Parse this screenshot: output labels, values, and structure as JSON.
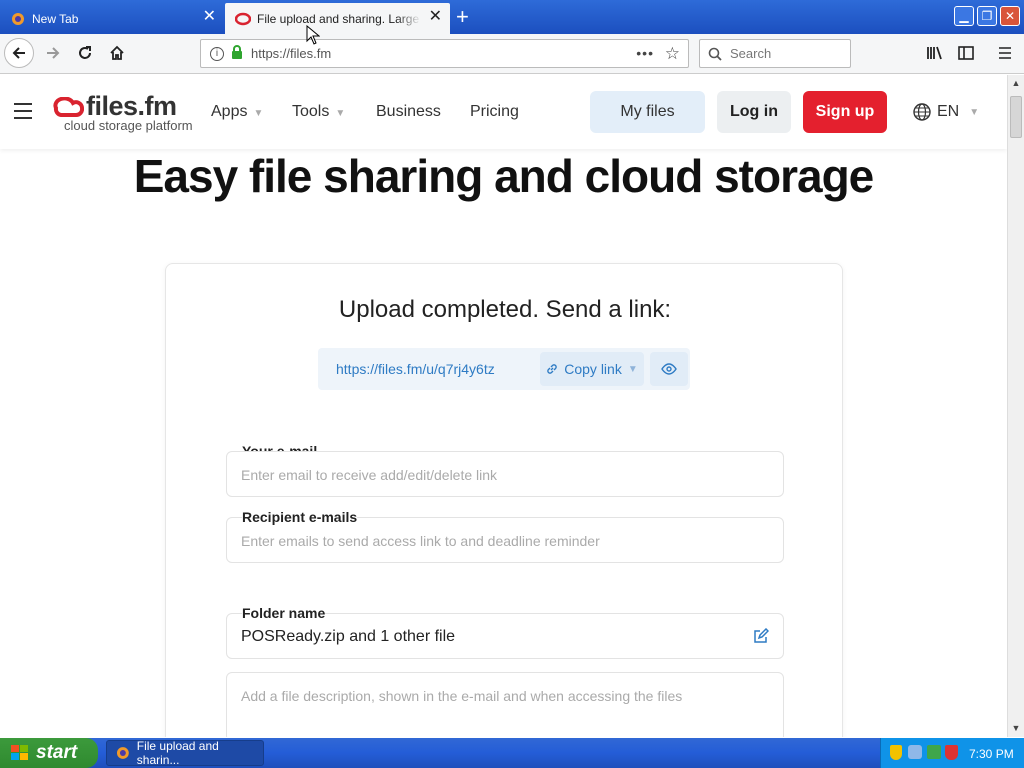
{
  "browser": {
    "tabs": [
      {
        "label": "New Tab",
        "active": false
      },
      {
        "label": "File upload and sharing. Large file t",
        "active": true
      }
    ],
    "url": "https://files.fm",
    "search_placeholder": "Search"
  },
  "header": {
    "logo_name": "files.fm",
    "logo_tagline": "cloud storage platform",
    "nav": [
      {
        "label": "Apps",
        "dropdown": true
      },
      {
        "label": "Tools",
        "dropdown": true
      },
      {
        "label": "Business",
        "dropdown": false
      },
      {
        "label": "Pricing",
        "dropdown": false
      }
    ],
    "my_files": "My files",
    "login": "Log in",
    "signup": "Sign up",
    "language": "EN"
  },
  "main": {
    "headline": "Easy file sharing and cloud storage",
    "upload_title": "Upload completed. Send a link:",
    "share_link": "https://files.fm/u/q7rj4y6tz",
    "copy_link_label": "Copy link",
    "email_label": "Your e-mail",
    "email_placeholder": "Enter email to receive add/edit/delete link",
    "recipient_label": "Recipient e-mails",
    "recipient_placeholder": "Enter emails to send access link to and deadline reminder",
    "folder_label": "Folder name",
    "folder_value": "POSReady.zip and 1 other file",
    "description_placeholder": "Add a file description, shown in the e-mail and when accessing the files"
  },
  "taskbar": {
    "start_label": "start",
    "task_item": "File upload and sharin...",
    "clock": "7:30 PM"
  },
  "colors": {
    "brand_red": "#e4202e",
    "link_blue": "#2e7bc4",
    "my_files_bg": "#e3eef9"
  }
}
